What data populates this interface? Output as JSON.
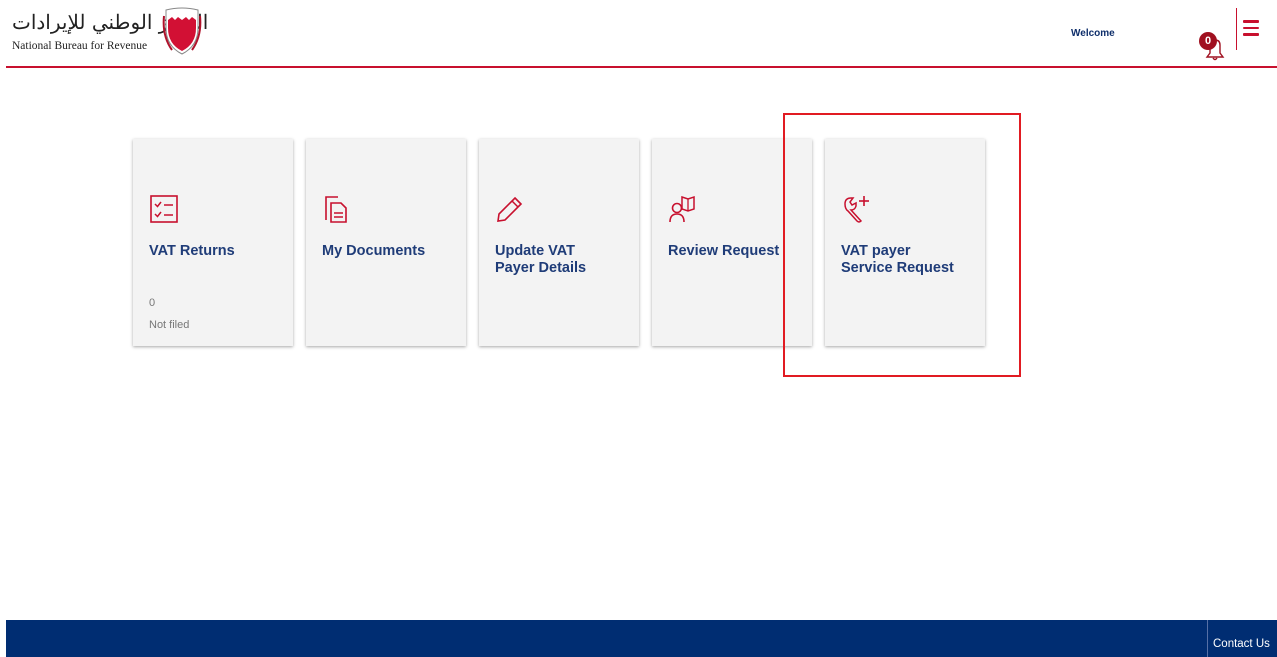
{
  "header": {
    "logo_arabic": "الجهاز الوطني للإيرادات",
    "logo_english": "National Bureau for Revenue",
    "welcome": "Welcome",
    "notification_count": "0"
  },
  "tiles": [
    {
      "icon": "checklist-icon",
      "title_lines": [
        "VAT Returns"
      ],
      "count": "0",
      "status": "Not filed"
    },
    {
      "icon": "documents-icon",
      "title_lines": [
        "My Documents"
      ]
    },
    {
      "icon": "pencil-icon",
      "title_lines": [
        "Update VAT",
        "Payer Details"
      ]
    },
    {
      "icon": "person-book-icon",
      "title_lines": [
        "Review Request"
      ]
    },
    {
      "icon": "wrench-plus-icon",
      "title_lines": [
        "VAT payer",
        "Service Request"
      ]
    }
  ],
  "footer": {
    "contact_label": "Contact Us"
  },
  "colors": {
    "brand_red": "#c8102e",
    "title_blue": "#1f3c78",
    "footer_navy": "#002d72",
    "highlight": "#e11b22"
  }
}
